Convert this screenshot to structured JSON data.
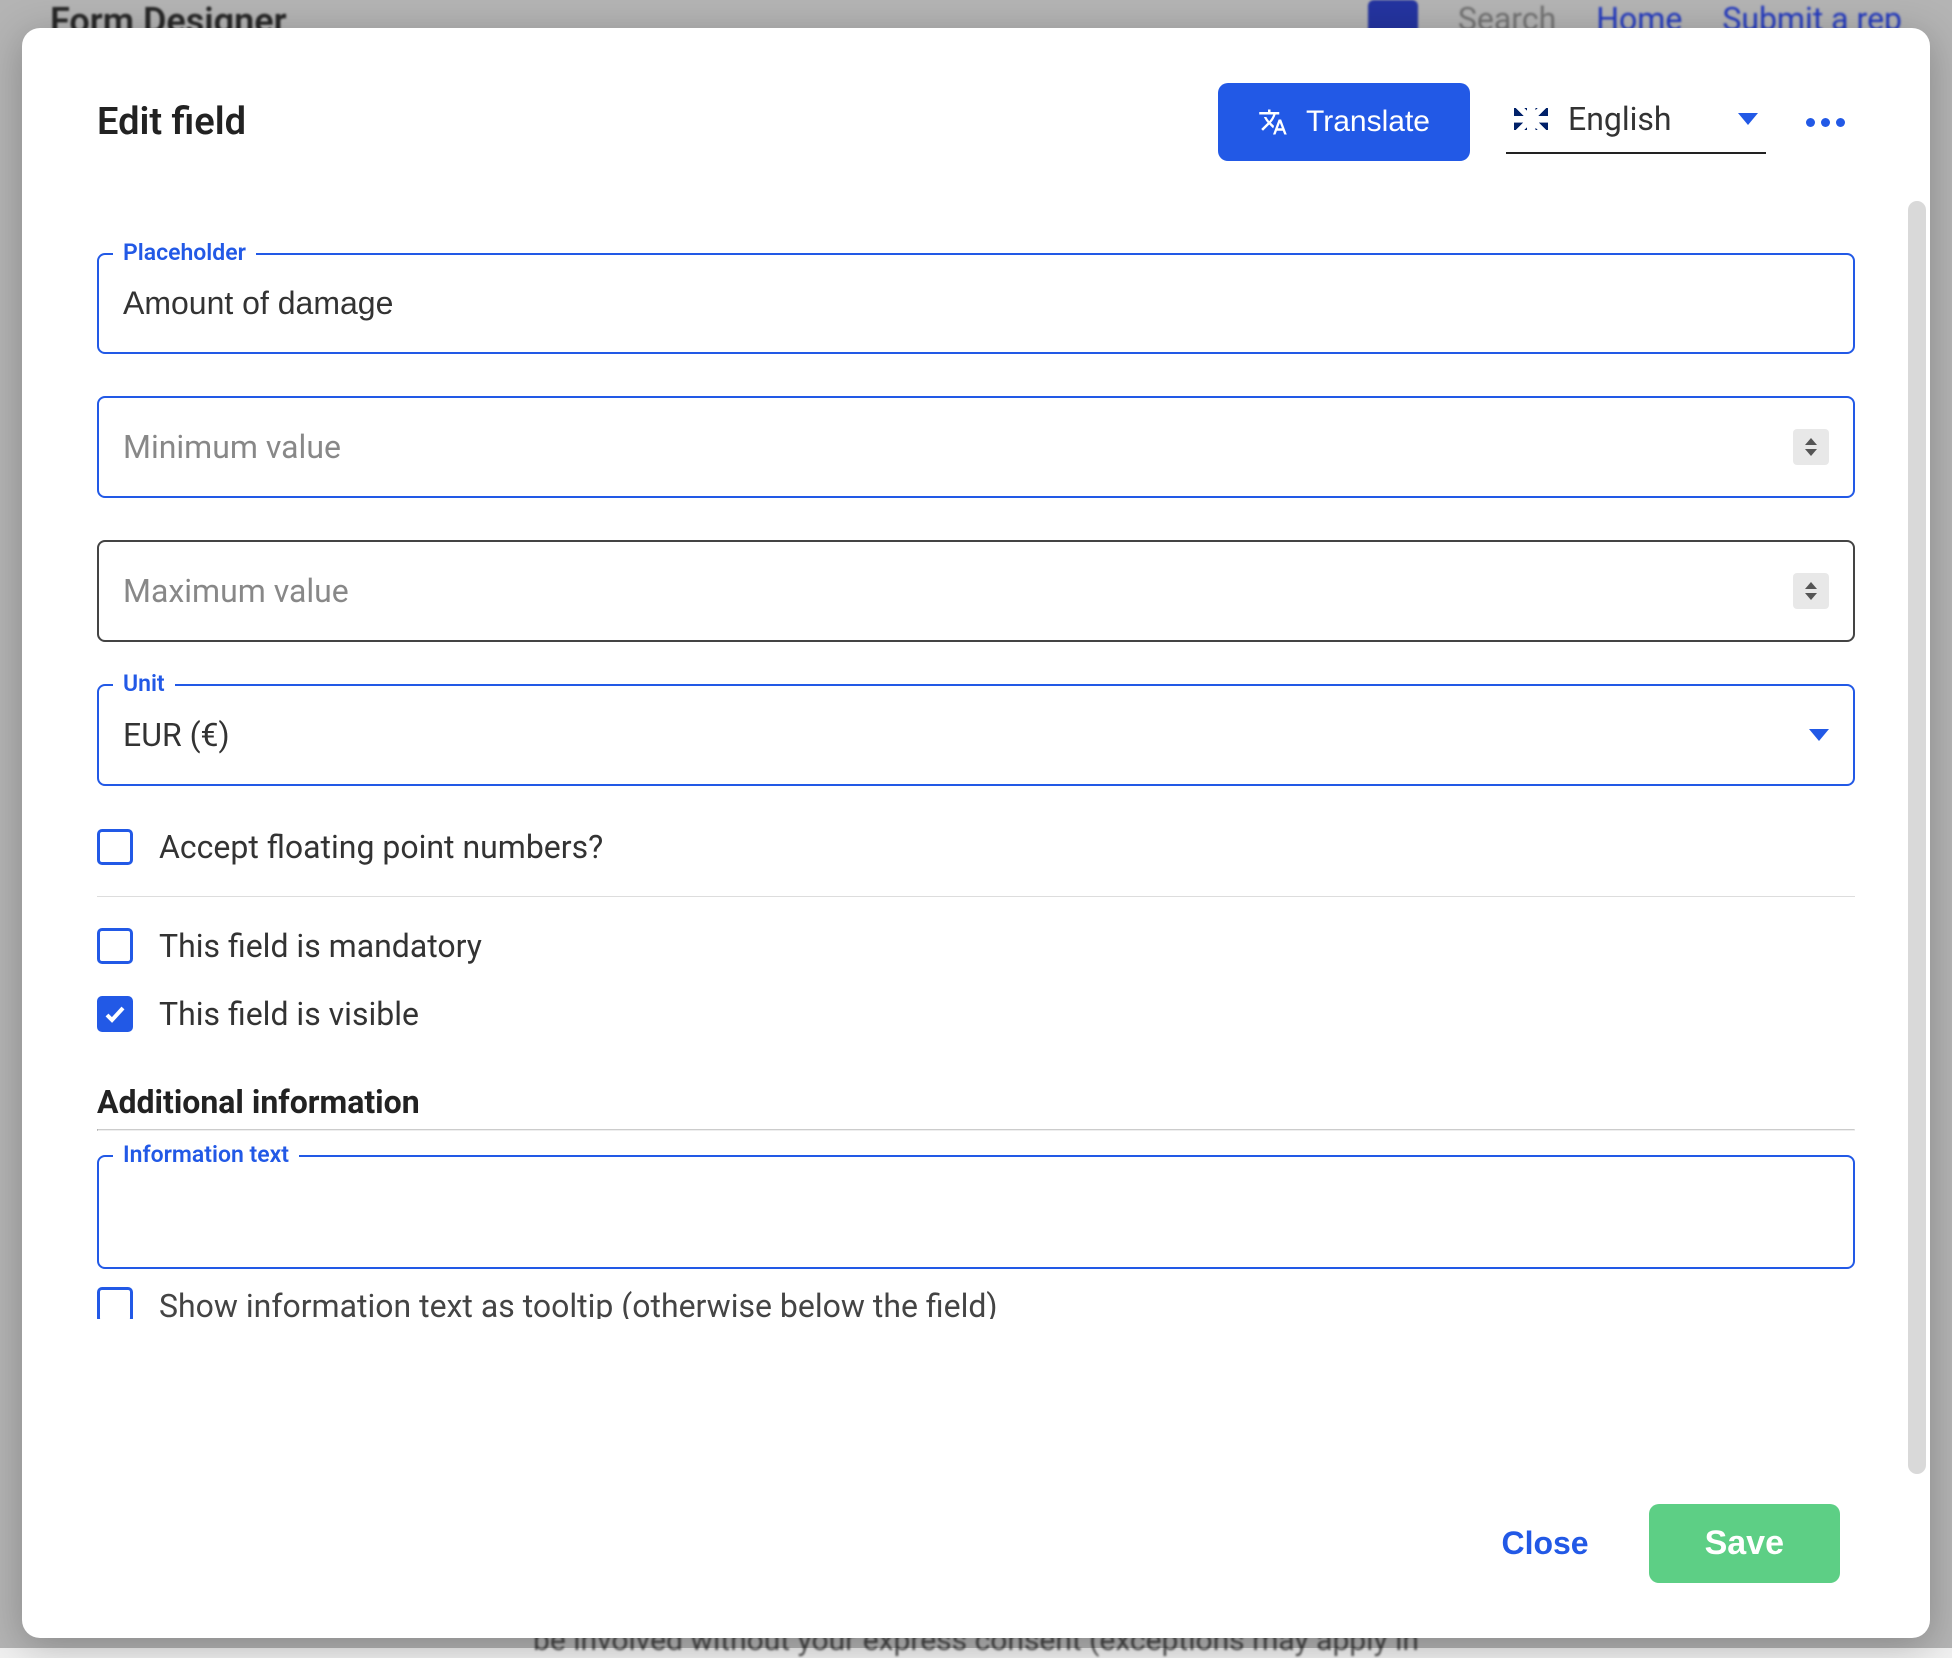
{
  "background": {
    "title": "Form Designer",
    "search_placeholder": "Search",
    "nav_home": "Home",
    "nav_submit": "Submit a rep",
    "bottom_text": "be involved without your express consent (exceptions may apply in"
  },
  "modal": {
    "title": "Edit field",
    "translate_button": "Translate",
    "language": "English",
    "fields": {
      "placeholder": {
        "label": "Placeholder",
        "value": "Amount of damage"
      },
      "min": {
        "placeholder": "Minimum value",
        "value": ""
      },
      "max": {
        "placeholder": "Maximum value",
        "value": ""
      },
      "unit": {
        "label": "Unit",
        "value": "EUR (€)"
      }
    },
    "checkboxes": {
      "floating": {
        "label": "Accept floating point numbers?",
        "checked": false
      },
      "mandatory": {
        "label": "This field is mandatory",
        "checked": false
      },
      "visible": {
        "label": "This field is visible",
        "checked": true
      },
      "tooltip": {
        "label": "Show information text as tooltip (otherwise below the field)",
        "checked": false
      }
    },
    "section_title": "Additional information",
    "info_text_label": "Information text",
    "info_text_value": "",
    "footer": {
      "close": "Close",
      "save": "Save"
    }
  }
}
